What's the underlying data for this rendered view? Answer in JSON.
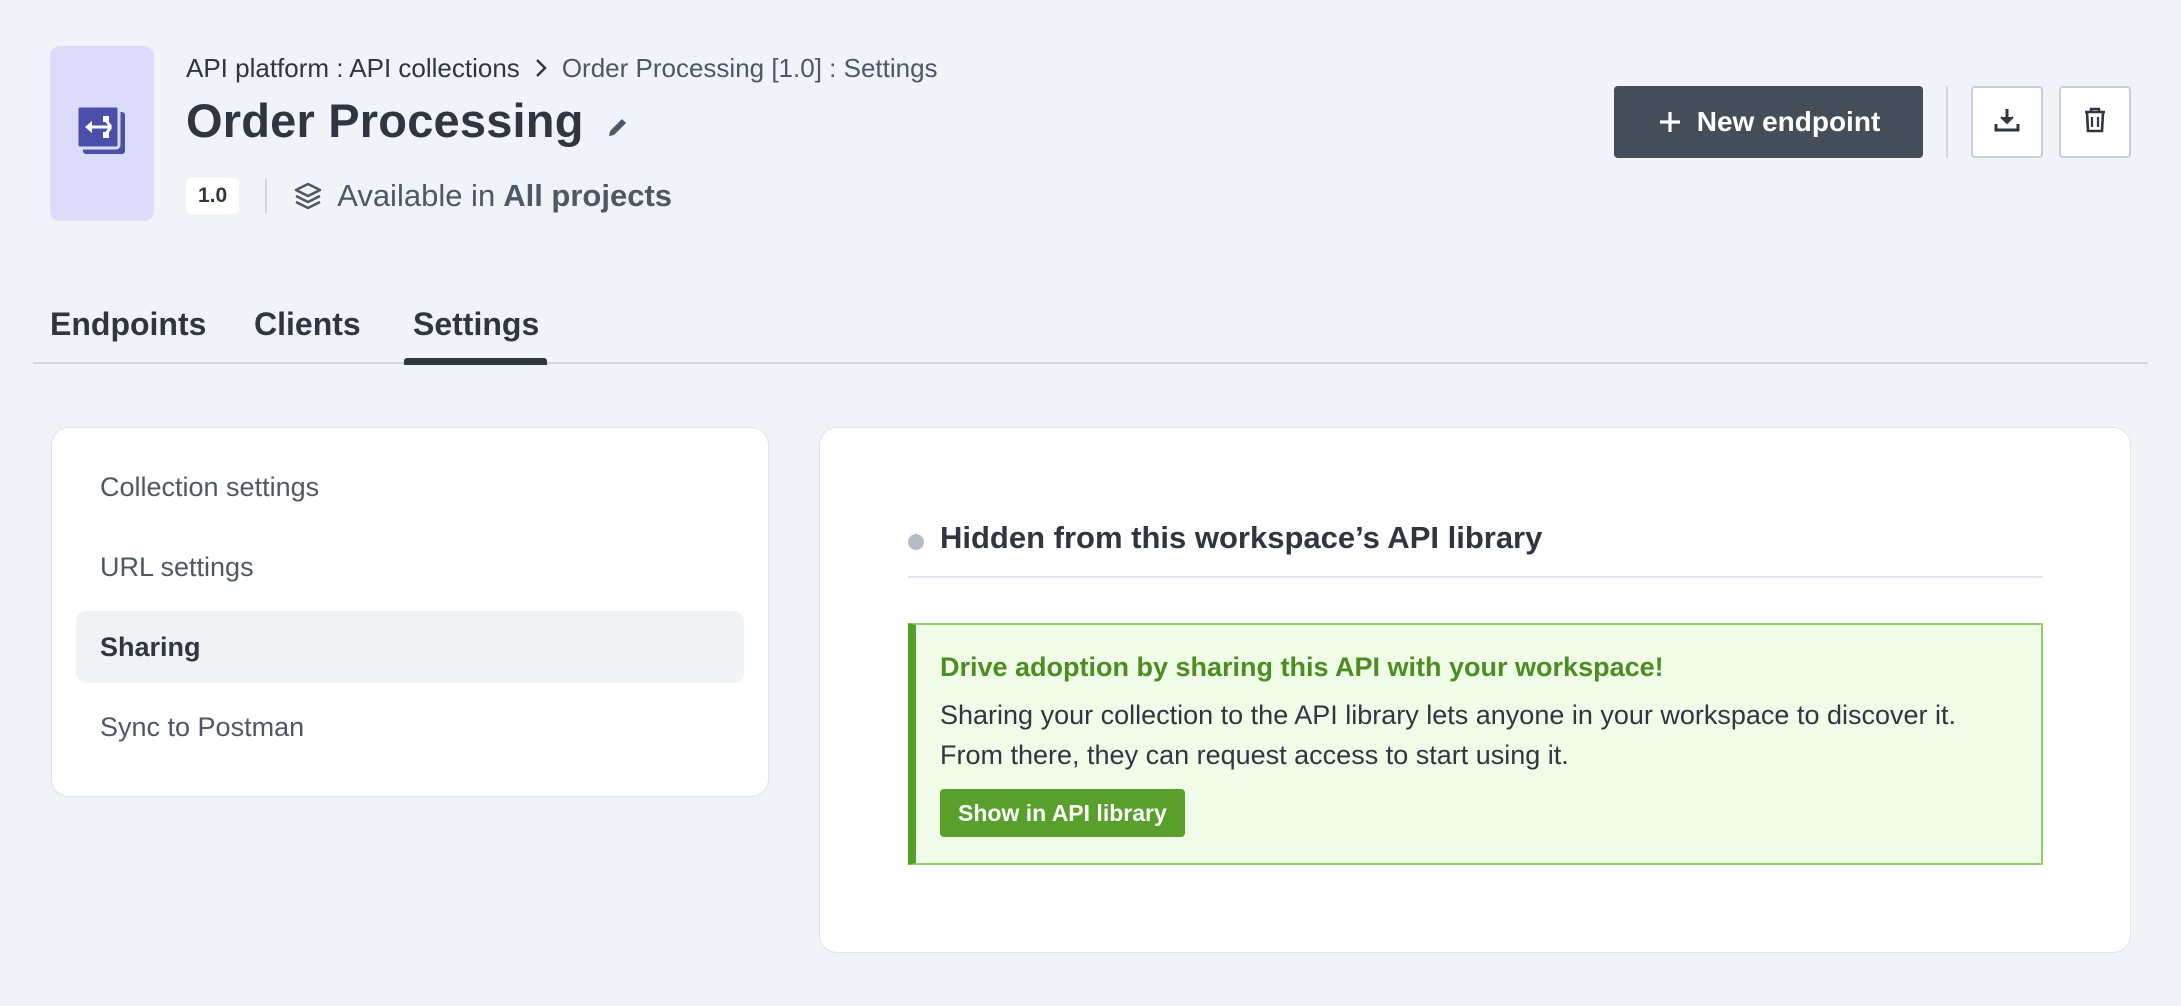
{
  "header": {
    "breadcrumb": {
      "parent": "API platform : API collections",
      "current": "Order Processing [1.0] : Settings"
    },
    "title": "Order Processing",
    "version": "1.0",
    "availability_prefix": "Available in",
    "availability_scope": "All projects"
  },
  "actions": {
    "new_endpoint_label": "New endpoint"
  },
  "tabs": [
    {
      "label": "Endpoints",
      "active": false
    },
    {
      "label": "Clients",
      "active": false
    },
    {
      "label": "Settings",
      "active": true
    }
  ],
  "settings_nav": {
    "items": [
      {
        "label": "Collection settings",
        "selected": false
      },
      {
        "label": "URL settings",
        "selected": false
      },
      {
        "label": "Sharing",
        "selected": true
      },
      {
        "label": "Sync to Postman",
        "selected": false
      }
    ]
  },
  "sharing": {
    "status": "Hidden from this workspace’s API library",
    "callout_title": "Drive adoption by sharing this API with your workspace!",
    "callout_body": "Sharing your collection to the API library lets anyone in your workspace to discover it. From there, they can request access to start using it.",
    "callout_button": "Show in API library"
  },
  "colors": {
    "primary_dark": "#454d59",
    "accent_green": "#58a02b",
    "callout_bg": "#f0fbe8",
    "icon_tile_bg": "#dcdcfa",
    "icon_tile_fg": "#4b4fa8"
  },
  "icons": {
    "collection": "api-collection-icon",
    "edit": "pencil-icon",
    "scope": "layers-icon",
    "download": "download-icon",
    "delete": "trash-icon"
  }
}
